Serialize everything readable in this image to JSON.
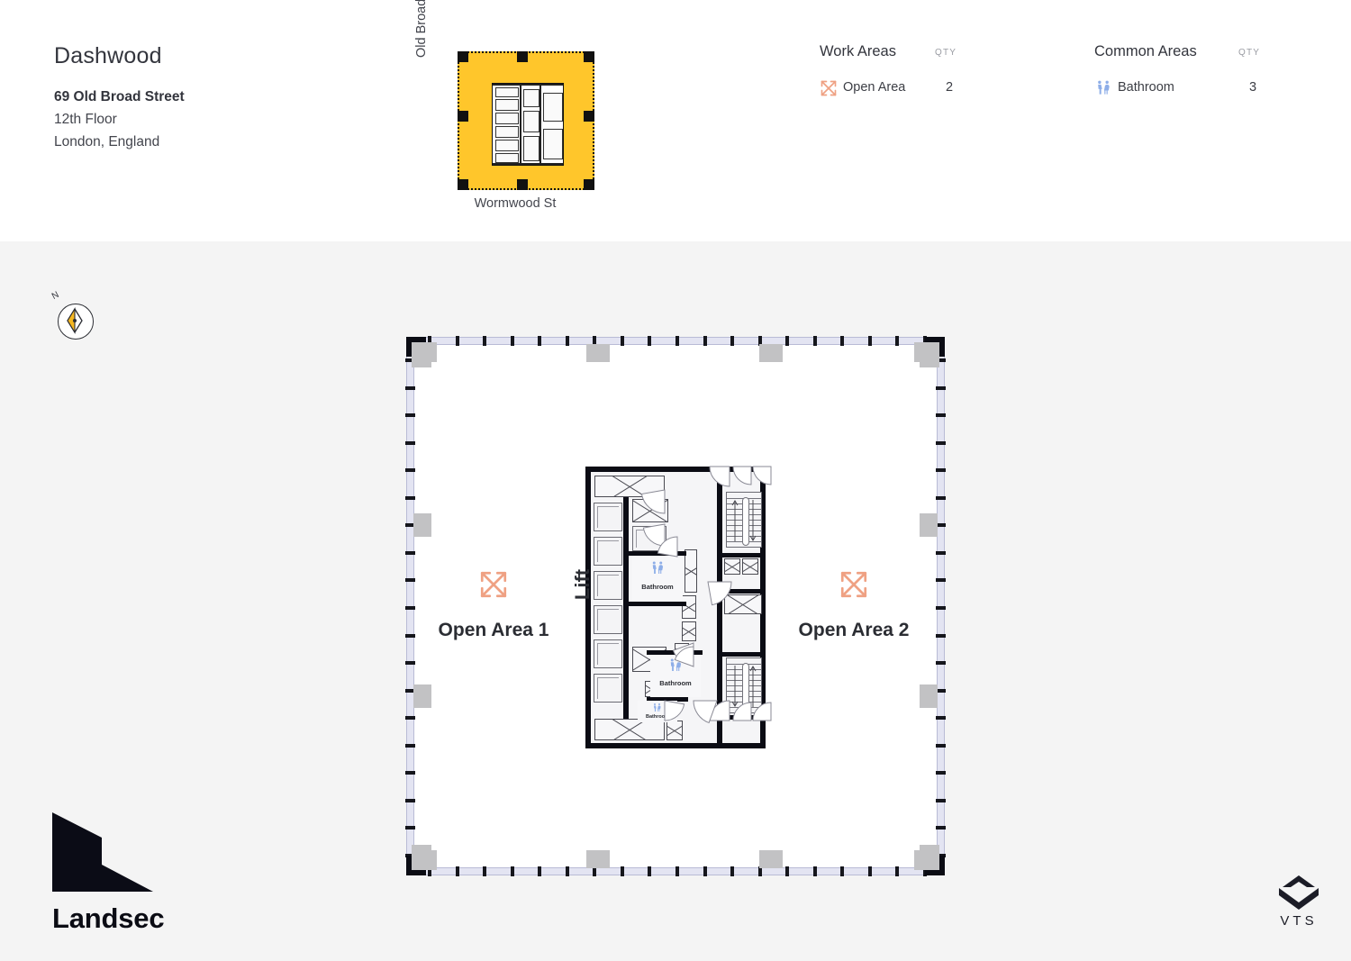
{
  "header": {
    "building_name": "Dashwood",
    "address": "69 Old Broad Street",
    "floor": "12th Floor",
    "city": "London, England"
  },
  "keyplan": {
    "street_left": "Old Broad Street",
    "street_bottom": "Wormwood St",
    "highlight_color": "#FFC62B"
  },
  "legend": {
    "work_areas": {
      "title": "Work Areas",
      "qty_header": "QTY",
      "items": [
        {
          "icon": "open-area-icon",
          "label": "Open Area",
          "qty": "2",
          "color": "#EFA183"
        }
      ]
    },
    "common_areas": {
      "title": "Common Areas",
      "qty_header": "QTY",
      "items": [
        {
          "icon": "bathroom-icon",
          "label": "Bathroom",
          "qty": "3",
          "color": "#8EAEE8"
        }
      ]
    }
  },
  "plan": {
    "compass_label": "N",
    "lift_label": "Lift",
    "open_areas": [
      {
        "label": "Open Area 1"
      },
      {
        "label": "Open Area 2"
      }
    ],
    "bathrooms": [
      {
        "label": "Bathroom"
      },
      {
        "label": "Bathroom"
      },
      {
        "label": "Bathroom"
      }
    ]
  },
  "footer": {
    "landsec_name": "Landsec",
    "vts_name": "VTS"
  }
}
